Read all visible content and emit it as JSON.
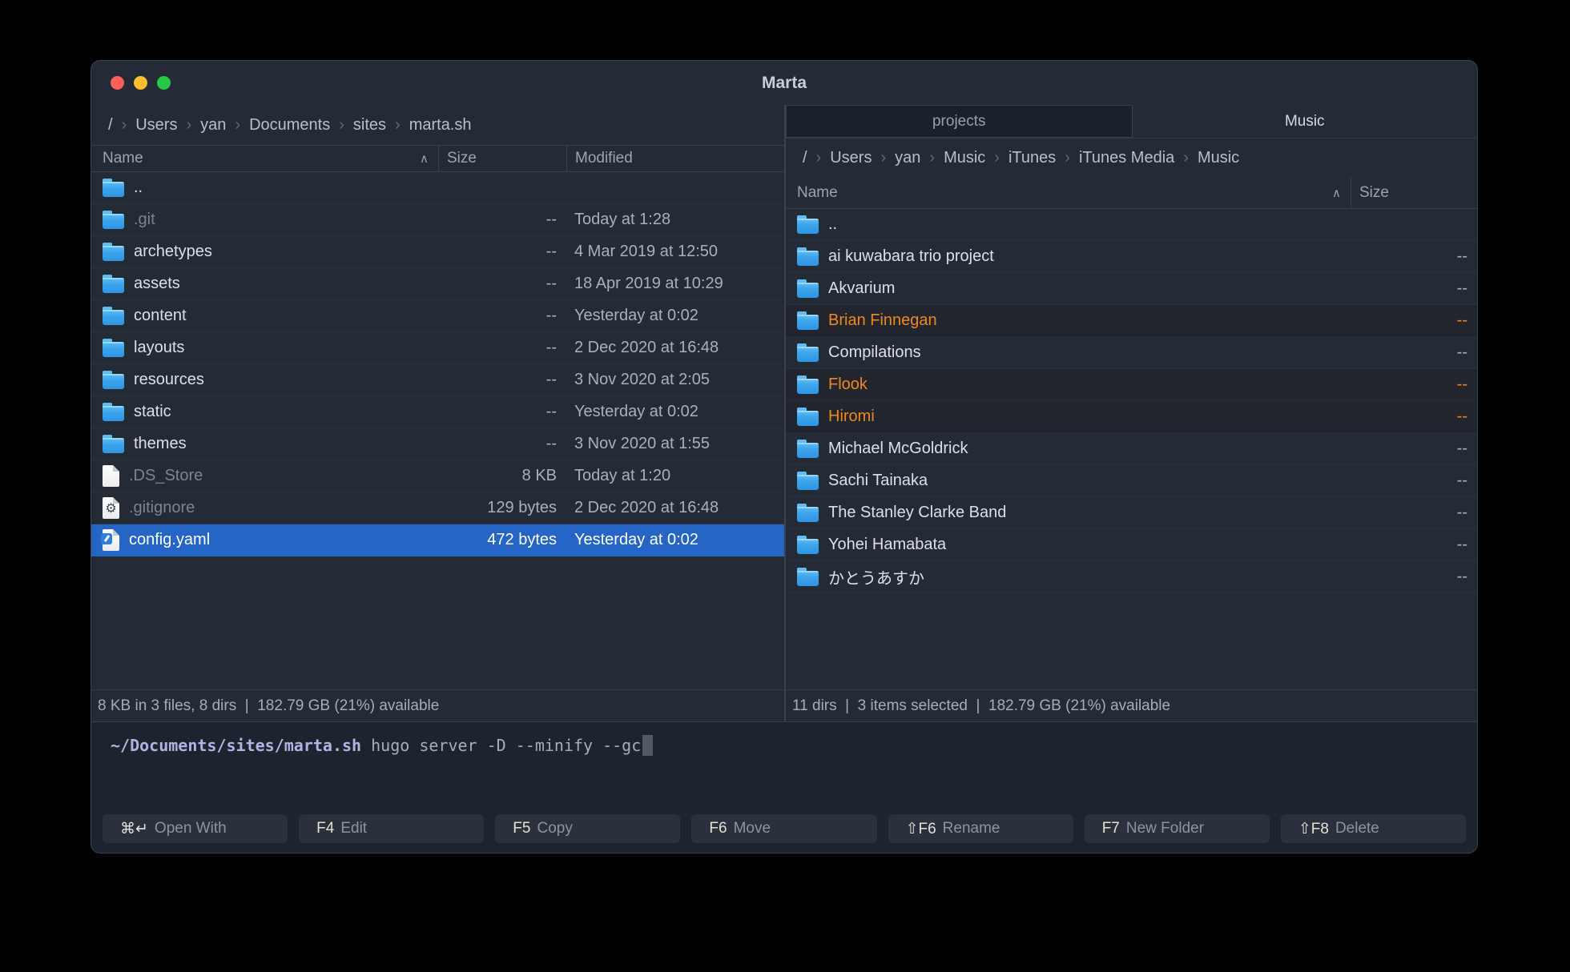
{
  "window": {
    "title": "Marta"
  },
  "colors": {
    "selection_blue": "#2465C5",
    "selection_orange": "#F0891D",
    "folder_blue": "#3BA4EC",
    "traffic_red": "#FF5F57",
    "traffic_yellow": "#FEBC2E",
    "traffic_green": "#28C840"
  },
  "left_pane": {
    "breadcrumb": [
      "/",
      "Users",
      "yan",
      "Documents",
      "sites",
      "marta.sh"
    ],
    "columns": {
      "name": "Name",
      "size": "Size",
      "modified": "Modified",
      "sort_indicator": "∧"
    },
    "rows": [
      {
        "name": "..",
        "size": "",
        "modified": "",
        "icon": "folder"
      },
      {
        "name": ".git",
        "size": "--",
        "modified": "Today at 1:28",
        "icon": "folder",
        "dim": true
      },
      {
        "name": "archetypes",
        "size": "--",
        "modified": "4 Mar 2019 at 12:50",
        "icon": "folder"
      },
      {
        "name": "assets",
        "size": "--",
        "modified": "18 Apr 2019 at 10:29",
        "icon": "folder"
      },
      {
        "name": "content",
        "size": "--",
        "modified": "Yesterday at 0:02",
        "icon": "folder"
      },
      {
        "name": "layouts",
        "size": "--",
        "modified": "2 Dec 2020 at 16:48",
        "icon": "folder"
      },
      {
        "name": "resources",
        "size": "--",
        "modified": "3 Nov 2020 at 2:05",
        "icon": "folder"
      },
      {
        "name": "static",
        "size": "--",
        "modified": "Yesterday at 0:02",
        "icon": "folder"
      },
      {
        "name": "themes",
        "size": "--",
        "modified": "3 Nov 2020 at 1:55",
        "icon": "folder"
      },
      {
        "name": ".DS_Store",
        "size": "8 KB",
        "modified": "Today at 1:20",
        "icon": "file",
        "dim": true
      },
      {
        "name": ".gitignore",
        "size": "129 bytes",
        "modified": "2 Dec 2020 at 16:48",
        "icon": "file-gear",
        "dim": true
      },
      {
        "name": "config.yaml",
        "size": "472 bytes",
        "modified": "Yesterday at 0:02",
        "icon": "file-yaml",
        "selected": true
      }
    ],
    "status": "8 KB in 3 files, 8 dirs  |  182.79 GB (21%) available"
  },
  "right_pane": {
    "tabs": [
      {
        "label": "projects",
        "active": false
      },
      {
        "label": "Music",
        "active": true
      }
    ],
    "breadcrumb": [
      "/",
      "Users",
      "yan",
      "Music",
      "iTunes",
      "iTunes Media",
      "Music"
    ],
    "columns": {
      "name": "Name",
      "size": "Size",
      "sort_indicator": "∧"
    },
    "rows": [
      {
        "name": "..",
        "size": "",
        "icon": "folder"
      },
      {
        "name": "ai kuwabara trio project",
        "size": "--",
        "icon": "folder"
      },
      {
        "name": "Akvarium",
        "size": "--",
        "icon": "folder"
      },
      {
        "name": "Brian Finnegan",
        "size": "--",
        "icon": "folder",
        "selected": true
      },
      {
        "name": "Compilations",
        "size": "--",
        "icon": "folder"
      },
      {
        "name": "Flook",
        "size": "--",
        "icon": "folder",
        "selected": true
      },
      {
        "name": "Hiromi",
        "size": "--",
        "icon": "folder",
        "selected": true
      },
      {
        "name": "Michael McGoldrick",
        "size": "--",
        "icon": "folder"
      },
      {
        "name": "Sachi Tainaka",
        "size": "--",
        "icon": "folder"
      },
      {
        "name": "The Stanley Clarke Band",
        "size": "--",
        "icon": "folder"
      },
      {
        "name": "Yohei Hamabata",
        "size": "--",
        "icon": "folder"
      },
      {
        "name": "かとうあすか",
        "size": "--",
        "icon": "folder"
      }
    ],
    "status": "11 dirs  |  3 items selected  |  182.79 GB (21%) available"
  },
  "terminal": {
    "path": "~/Documents/sites/marta.sh",
    "command": " hugo server -D --minify --gc"
  },
  "function_bar": [
    {
      "key": "⌘↵",
      "label": "Open With"
    },
    {
      "key": "F4",
      "label": "Edit"
    },
    {
      "key": "F5",
      "label": "Copy"
    },
    {
      "key": "F6",
      "label": "Move"
    },
    {
      "key": "⇧F6",
      "label": "Rename"
    },
    {
      "key": "F7",
      "label": "New Folder"
    },
    {
      "key": "⇧F8",
      "label": "Delete"
    }
  ]
}
